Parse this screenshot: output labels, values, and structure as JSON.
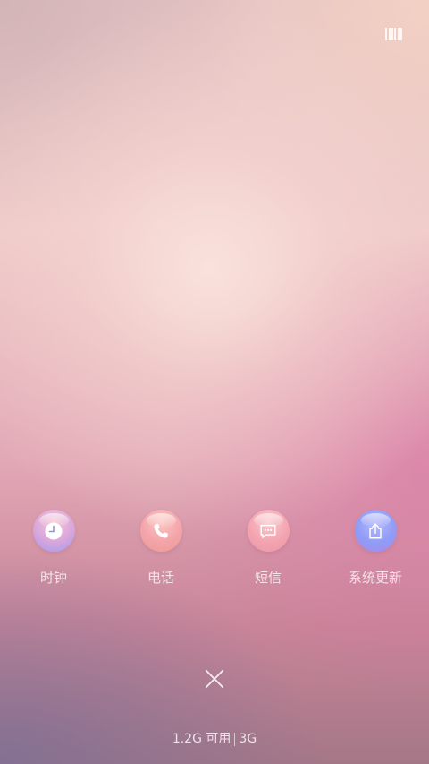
{
  "screen": {
    "name": "recent-apps-overview",
    "manage_icon": "manage-barcode-icon"
  },
  "apps": [
    {
      "label": "时钟",
      "icon": "clock-icon",
      "color": "#b8a6e6"
    },
    {
      "label": "电话",
      "icon": "phone-icon",
      "color": "#f3a4a8"
    },
    {
      "label": "短信",
      "icon": "message-icon",
      "color": "#f3a4b0"
    },
    {
      "label": "系统更新",
      "icon": "share-upload-icon",
      "color": "#8f9cf6"
    }
  ],
  "close": {
    "icon": "close-icon"
  },
  "memory": {
    "available": "1.2G 可用",
    "total": "3G"
  }
}
